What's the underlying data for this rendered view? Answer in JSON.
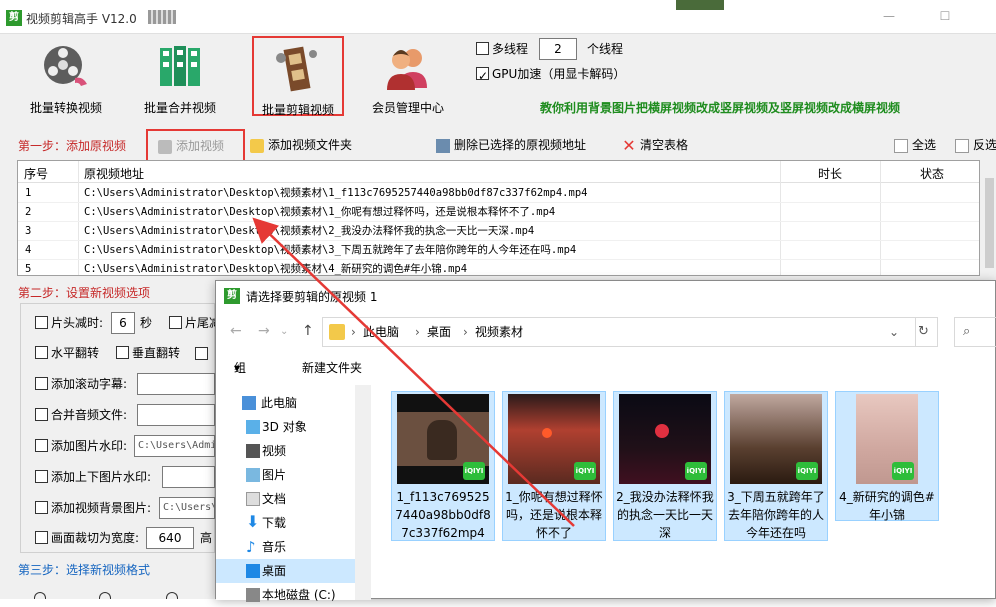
{
  "titlebar": {
    "title": "视频剪辑高手 V12.0"
  },
  "toolbar": {
    "batch_convert": "批量转换视频",
    "batch_merge": "批量合并视频",
    "batch_edit": "批量剪辑视频",
    "member_center": "会员管理中心"
  },
  "options_top": {
    "multithread_label": "多线程",
    "thread_count": "2",
    "thread_unit": "个线程",
    "gpu_label": "GPU加速（用显卡解码）",
    "promo": "教你利用背景图片把横屏视频改成竖屏视频及竖屏视频改成横屏视频"
  },
  "step1": {
    "label": "第一步：添加原视频",
    "add_video": "添加视频",
    "add_folder": "添加视频文件夹",
    "delete_selected": "删除已选择的原视频地址",
    "clear_table": "清空表格",
    "select_all": "全选",
    "invert": "反选"
  },
  "table": {
    "headers": {
      "index": "序号",
      "path": "原视频地址",
      "duration": "时长",
      "status": "状态"
    },
    "rows": [
      {
        "n": "1",
        "path": "C:\\Users\\Administrator\\Desktop\\视频素材\\1_f113c7695257440a98bb0df87c337f62mp4.mp4"
      },
      {
        "n": "2",
        "path": "C:\\Users\\Administrator\\Desktop\\视频素材\\1_你呢有想过释怀吗，还是说根本释怀不了.mp4"
      },
      {
        "n": "3",
        "path": "C:\\Users\\Administrator\\Desktop\\视频素材\\2_我没办法释怀我的执念一天比一天深.mp4"
      },
      {
        "n": "4",
        "path": "C:\\Users\\Administrator\\Desktop\\视频素材\\3_下周五就跨年了去年陪你跨年的人今年还在吗.mp4"
      },
      {
        "n": "5",
        "path": "C:\\Users\\Administrator\\Desktop\\视频素材\\4_新研究的调色#年小锦.mp4"
      }
    ]
  },
  "step2": {
    "label": "第二步：设置新视频选项",
    "head_cut": "片头减时:",
    "head_cut_value": "6",
    "seconds": "秒",
    "tail_cut": "片尾减",
    "flip_h": "水平翻转",
    "flip_v": "垂直翻转",
    "scroll_subtitle": "添加滚动字幕:",
    "merge_audio": "合并音频文件:",
    "image_watermark": "添加图片水印:",
    "image_watermark_value": "C:\\Users\\Admi",
    "tb_watermark": "添加上下图片水印:",
    "bg_image": "添加视频背景图片:",
    "bg_image_value": "C:\\Users\\",
    "crop_width": "画面裁切为宽度:",
    "crop_width_value": "640",
    "height": "高"
  },
  "step3": {
    "label": "第三步：选择新视频格式"
  },
  "dialog": {
    "title": "请选择要剪辑的原视频 1",
    "breadcrumb": [
      "此电脑",
      "桌面",
      "视频素材"
    ],
    "organize": "组织",
    "new_folder": "新建文件夹",
    "nav": [
      {
        "label": "此电脑"
      },
      {
        "label": "3D 对象"
      },
      {
        "label": "视频"
      },
      {
        "label": "图片"
      },
      {
        "label": "文档"
      },
      {
        "label": "下载"
      },
      {
        "label": "音乐"
      },
      {
        "label": "桌面"
      },
      {
        "label": "本地磁盘 (C:)"
      }
    ],
    "files": [
      {
        "name": "1_f113c7695257440a98bb0df87c337f62mp4"
      },
      {
        "name": "1_你呢有想过释怀吗，还是说根本释怀不了"
      },
      {
        "name": "2_我没办法释怀我的执念一天比一天深"
      },
      {
        "name": "3_下周五就跨年了去年陪你跨年的人今年还在吗"
      },
      {
        "name": "4_新研究的调色#年小锦"
      }
    ],
    "badge": "iQIYI"
  },
  "colors": {
    "highlight": "#e53935",
    "promo": "#1e8c1e",
    "step": "#c62828",
    "selection": "#cce8ff"
  }
}
